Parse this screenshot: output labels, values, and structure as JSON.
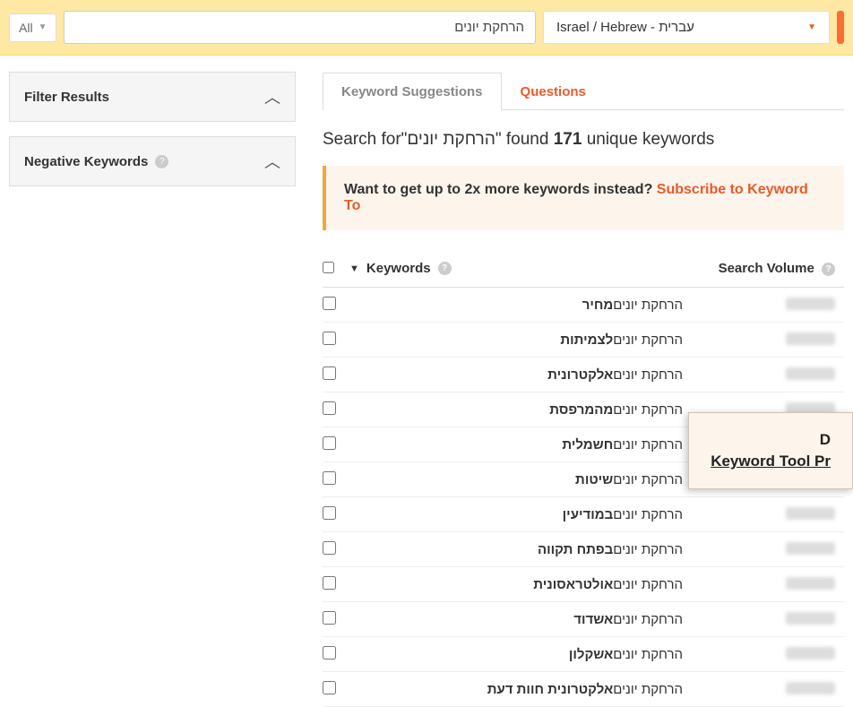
{
  "topbar": {
    "all_label": "All",
    "search_value": "הרחקת יונים",
    "locale_label": "Israel / Hebrew - עברית"
  },
  "sidebar": {
    "filter_label": "Filter Results",
    "negative_label": "Negative Keywords"
  },
  "tabs": {
    "suggestions": "Keyword Suggestions",
    "questions": "Questions"
  },
  "summary": {
    "prefix": "Search for",
    "term": "הרחקת יונים",
    "found": "found",
    "count": "171",
    "suffix": "unique keywords"
  },
  "promo": {
    "text": "Want to get up to 2x more keywords instead?",
    "link": "Subscribe to Keyword To"
  },
  "columns": {
    "keywords": "Keywords",
    "volume": "Search Volume"
  },
  "rows": [
    {
      "bold": "מחיר",
      "rest": "הרחקת יונים"
    },
    {
      "bold": "לצמיתות",
      "rest": "הרחקת יונים"
    },
    {
      "bold": "אלקטרונית",
      "rest": "הרחקת יונים"
    },
    {
      "bold": "מהמרפסת",
      "rest": "הרחקת יונים"
    },
    {
      "bold": "חשמלית",
      "rest": "הרחקת יונים"
    },
    {
      "bold": "שיטות",
      "rest": "הרחקת יונים"
    },
    {
      "bold": "במודיעין",
      "rest": "הרחקת יונים"
    },
    {
      "bold": "בפתח תקווה",
      "rest": "הרחקת יונים"
    },
    {
      "bold": "אולטראסונית",
      "rest": "הרחקת יונים"
    },
    {
      "bold": "אשדוד",
      "rest": "הרחקת יונים"
    },
    {
      "bold": "אשקלון",
      "rest": "הרחקת יונים"
    },
    {
      "bold": "אלקטרונית חוות דעת",
      "rest": "הרחקת יונים"
    }
  ],
  "popup": {
    "line1": "D",
    "line2": "Keyword Tool Pr"
  }
}
